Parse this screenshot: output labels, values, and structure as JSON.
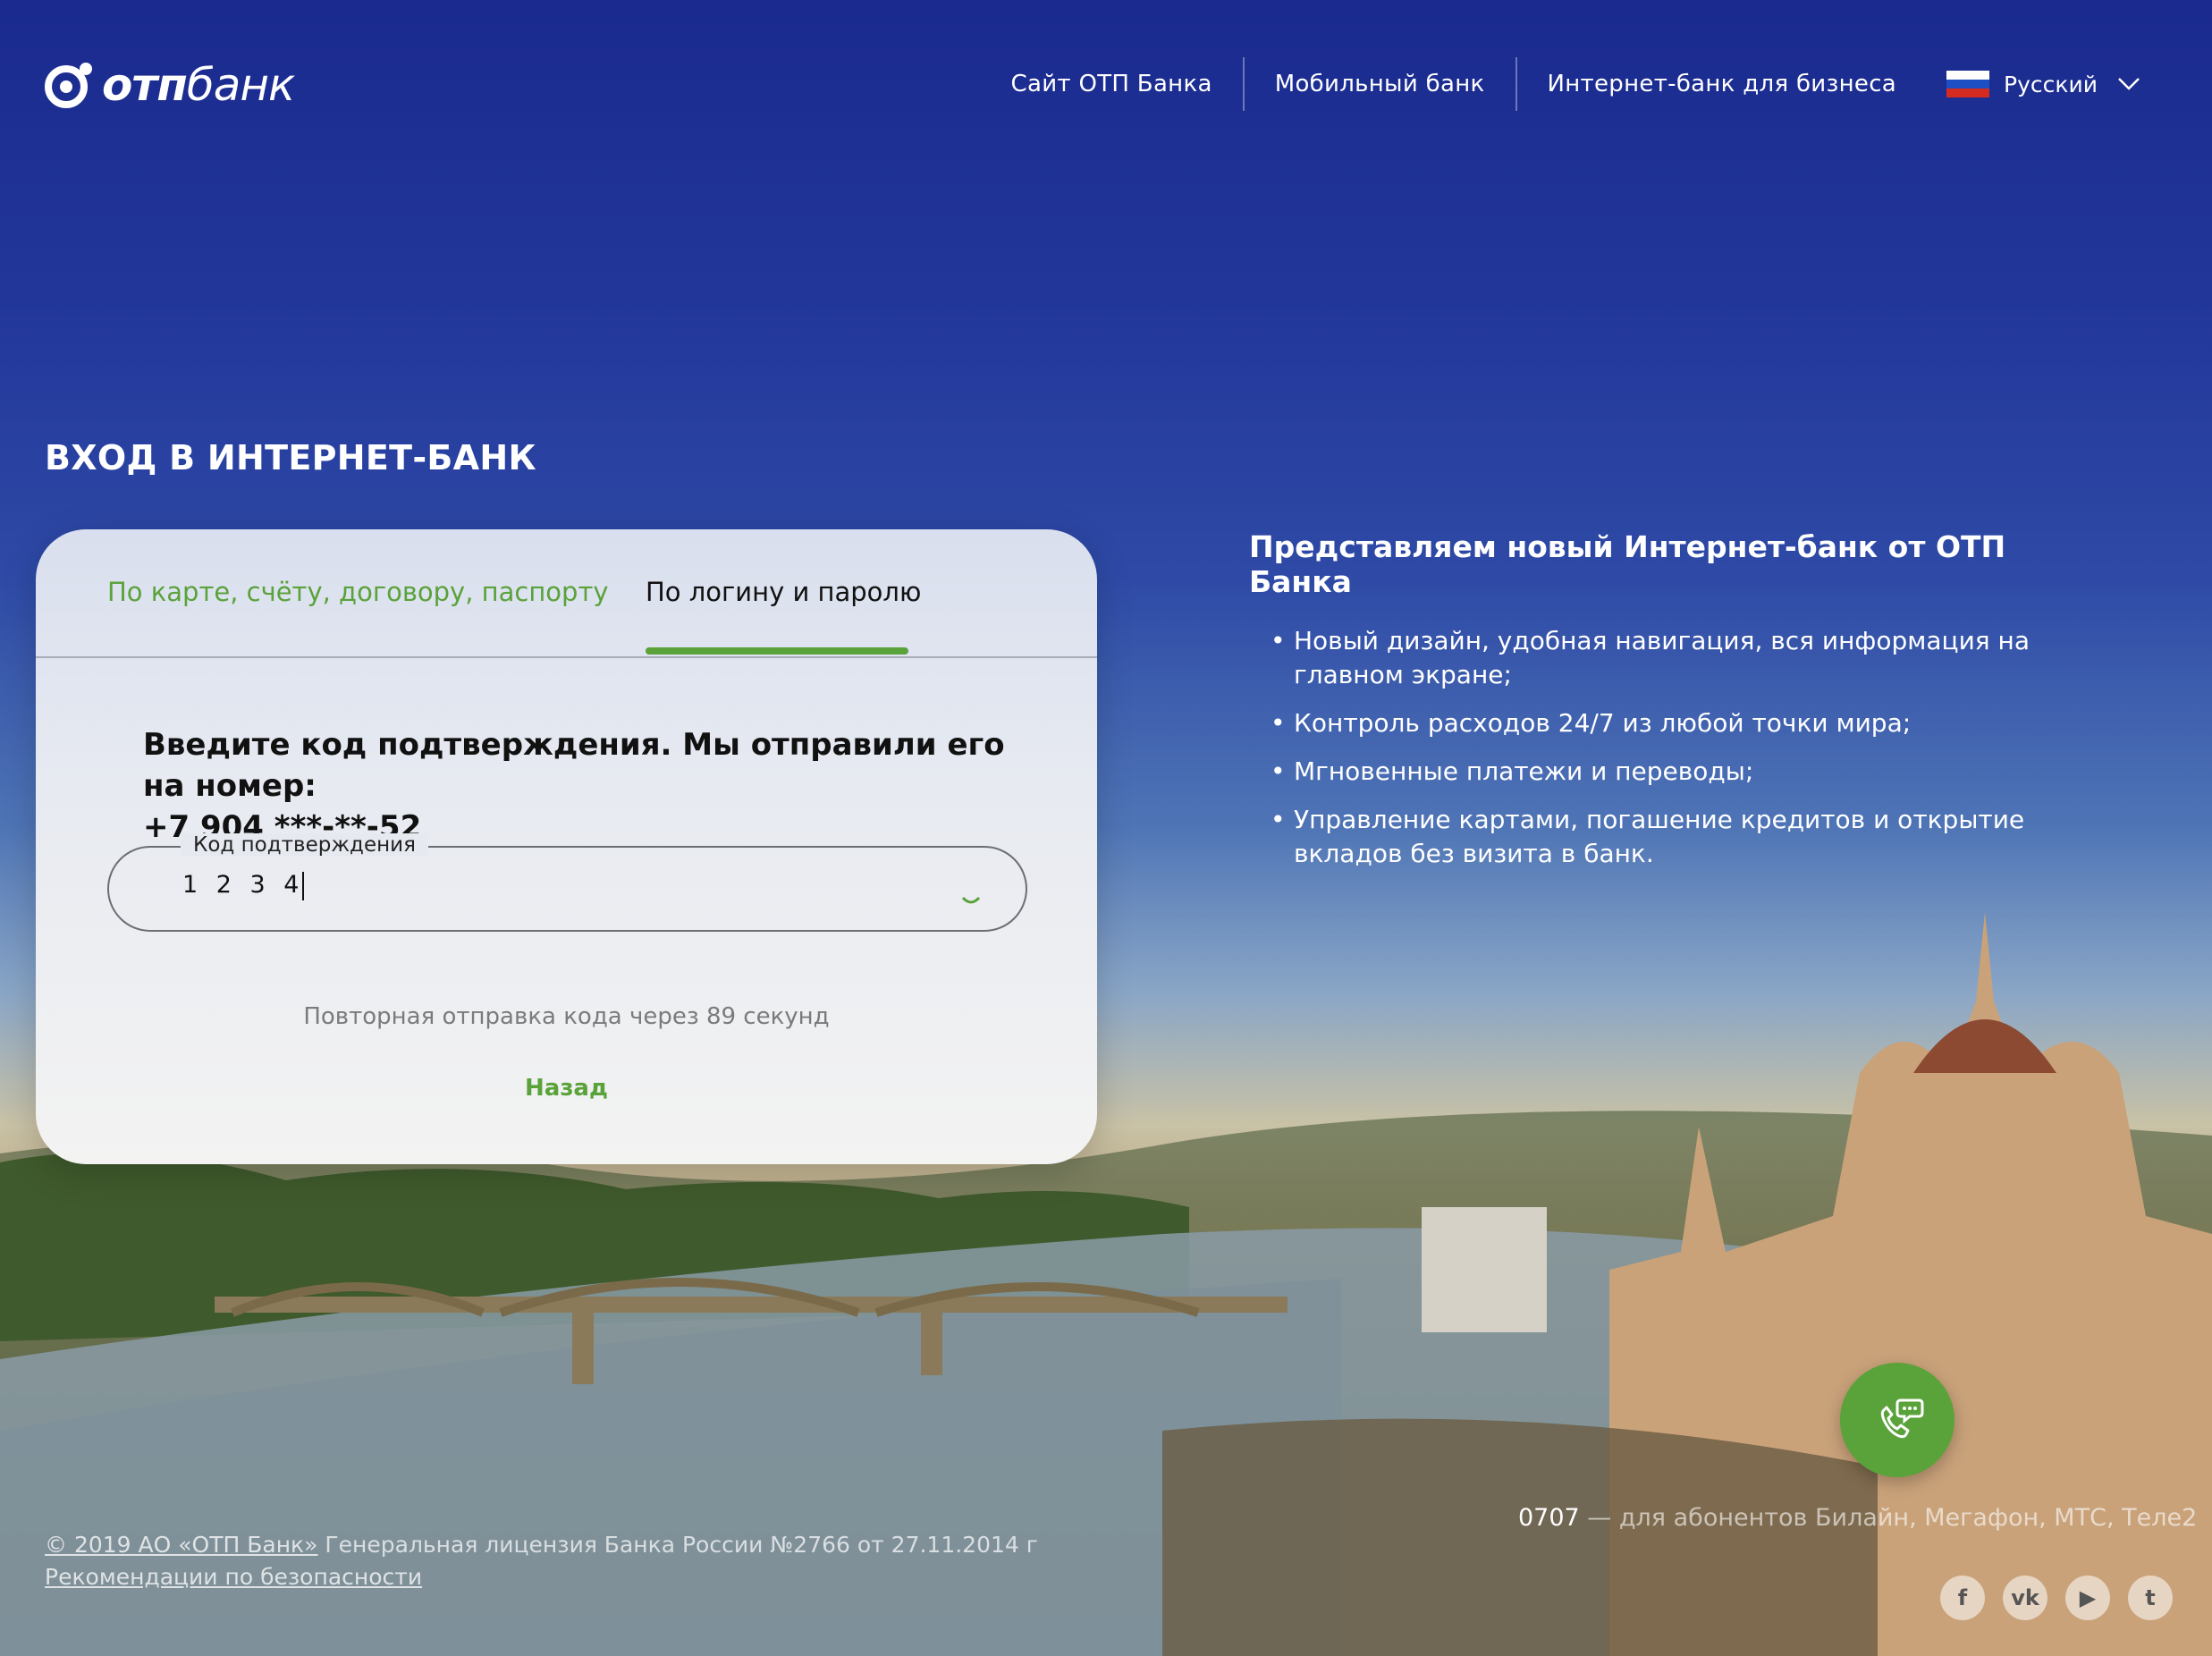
{
  "brand": {
    "logo_word_1": "отп",
    "logo_word_2": "банк",
    "green": "#5aa23a"
  },
  "nav": {
    "links": [
      "Сайт ОТП Банка",
      "Мобильный банк",
      "Интернет-банк для бизнеса"
    ],
    "language": "Русский"
  },
  "page_title": "ВХОД В ИНТЕРНЕТ-БАНК",
  "login_card": {
    "tabs": [
      {
        "label": "По карте, счёту, договору, паспорту",
        "active": false
      },
      {
        "label": "По логину и паролю",
        "active": true
      }
    ],
    "instruction_line1": "Введите код подтверждения. Мы отправили его на номер:",
    "instruction_line2": "+7 904 ***-**-52",
    "code_field": {
      "label": "Код подтверждения",
      "value": "1 2 3 4"
    },
    "resend_text": "Повторная отправка кода через 89 секунд",
    "back_label": "Назад"
  },
  "promo": {
    "title": "Представляем новый Интернет-банк от ОТП Банка",
    "items": [
      "Новый дизайн, удобная навигация, вся информация на главном экране;",
      "Контроль расходов 24/7 из любой точки мира;",
      "Мгновенные платежи и переводы;",
      "Управление картами, погашение кредитов и открытие вкладов без визита в банк."
    ]
  },
  "support": {
    "phone": "0707",
    "phone_desc": " — для абонентов Билайн, Мегафон, МТС, Теле2",
    "call_icon": "phone-chat-icon"
  },
  "footer": {
    "copyright_link": "© 2019 АО «ОТП Банк»",
    "license_text": " Генеральная лицензия Банка России №2766 от 27.11.2014 г",
    "security_link": "Рекомендации по безопасности"
  },
  "social": [
    {
      "icon": "facebook-icon",
      "glyph": "f"
    },
    {
      "icon": "vk-icon",
      "glyph": "vk"
    },
    {
      "icon": "youtube-icon",
      "glyph": "▶"
    },
    {
      "icon": "twitter-icon",
      "glyph": "t"
    }
  ]
}
